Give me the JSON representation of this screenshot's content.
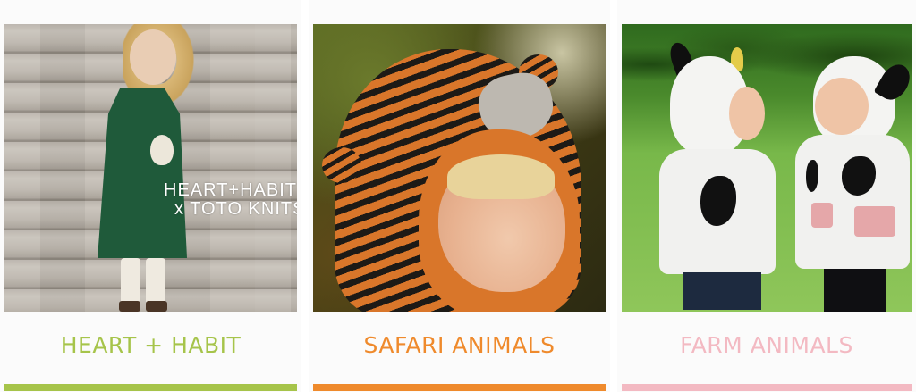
{
  "cards": [
    {
      "label": "HEART + HABIT",
      "color": "#a6c44a",
      "photo": {
        "overlay_line1": "HEART+HABIT",
        "overlay_line2": "x TOTO KNITS"
      }
    },
    {
      "label": "SAFARI ANIMALS",
      "color": "#ef8a2c"
    },
    {
      "label": "FARM ANIMALS",
      "color": "#f3b9c2"
    }
  ]
}
